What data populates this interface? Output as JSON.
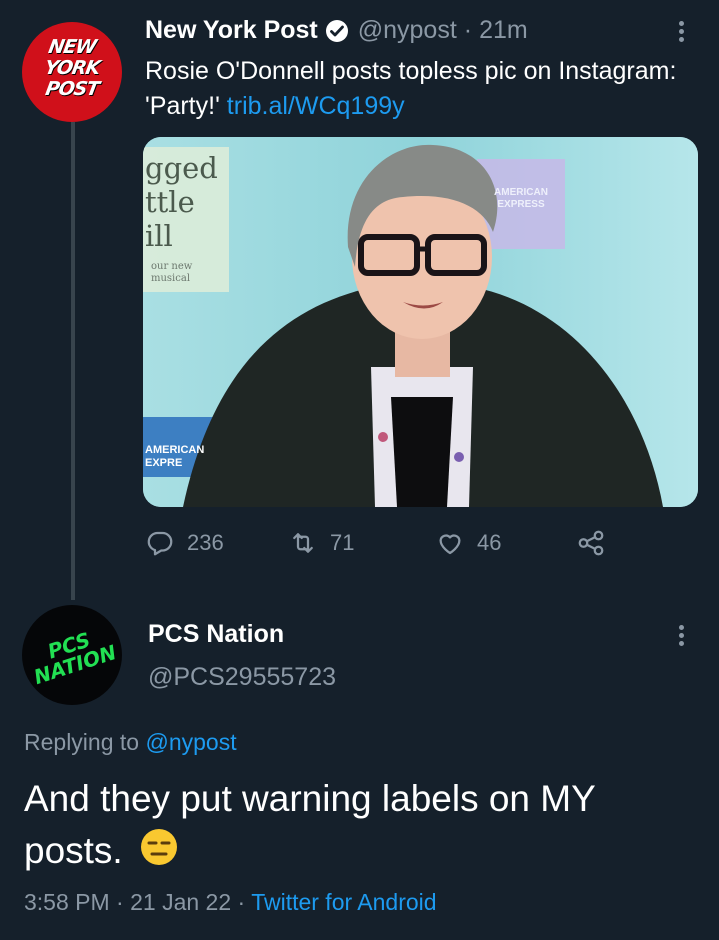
{
  "original_tweet": {
    "display_name": "New York Post",
    "handle": "@nypost",
    "separator": "·",
    "time_ago": "21m",
    "text": "Rosie O'Donnell posts topless pic on Instagram: 'Party!'",
    "link": "trib.al/WCq199y",
    "avatar_logo": [
      "NEW",
      "YORK",
      "POST"
    ],
    "media": {
      "backdrop_text": [
        "gged",
        "ttle",
        "ill"
      ],
      "backdrop_small_text": [
        "our new",
        "musical"
      ],
      "sponsor_top": [
        "AMERICAN",
        "EXPRESS"
      ],
      "sponsor_bottom": [
        "AMERICAN",
        "EXPRE"
      ]
    },
    "actions": {
      "replies": "236",
      "retweets": "71",
      "likes": "46"
    }
  },
  "reply_tweet": {
    "display_name": "PCS Nation",
    "handle": "@PCS29555723",
    "avatar_logo": [
      "PCS",
      "NATION"
    ],
    "replying_to_label": "Replying to",
    "replying_to_handle": "@nypost",
    "text_line1": "And they put warning labels on MY",
    "text_line2": "posts.",
    "emoji": "😑",
    "time": "3:58 PM",
    "separator": "·",
    "date": "21 Jan 22",
    "source": "Twitter for Android"
  },
  "colors": {
    "background": "#15202b",
    "accent": "#1d9bf0",
    "muted_text": "#8b98a5",
    "nypost_red": "#d0101a",
    "pcs_green": "#22e053"
  }
}
